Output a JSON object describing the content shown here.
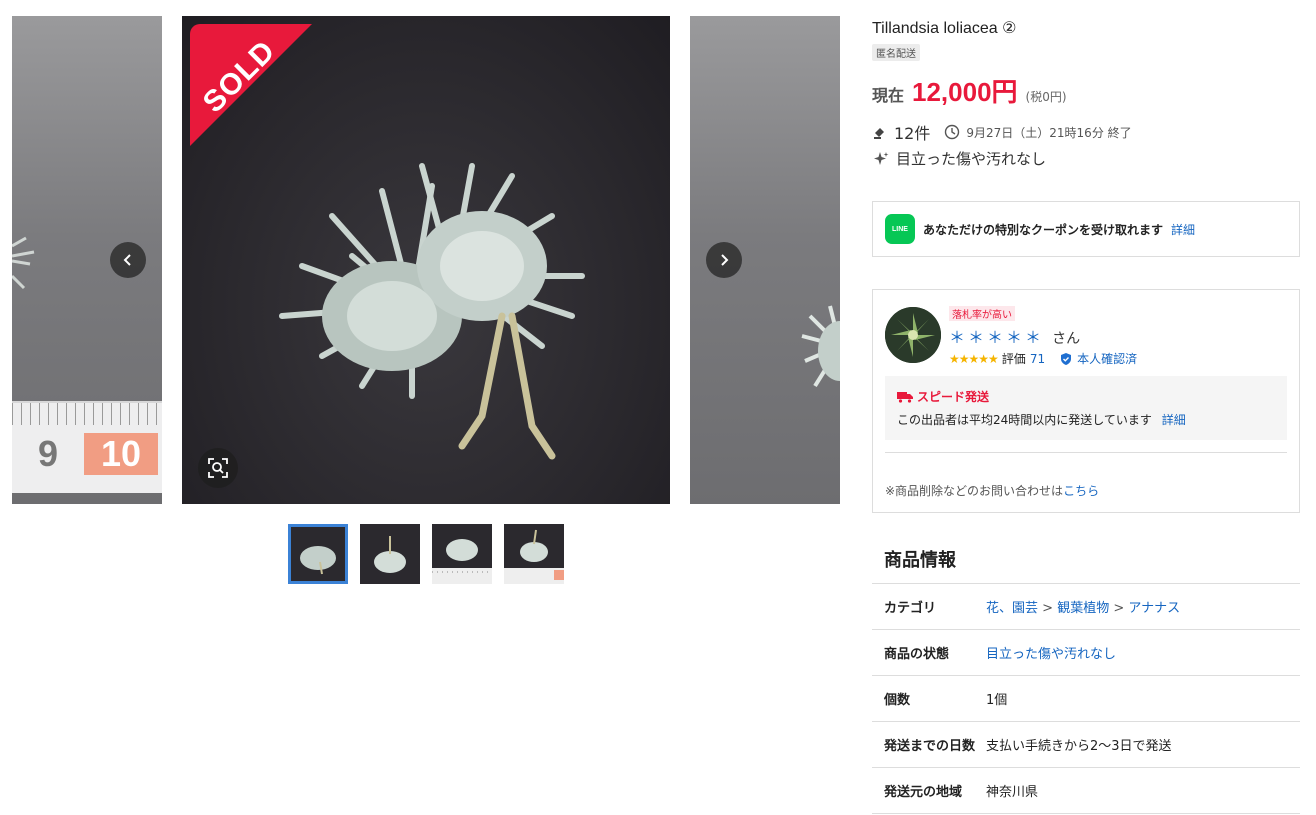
{
  "gallery": {
    "sold_label": "SOLD",
    "ruler_left": "9",
    "ruler_right": "10",
    "thumb_count": 4
  },
  "item": {
    "title": "Tillandsia loliacea ②",
    "anon_badge": "匿名配送",
    "price_label": "現在",
    "price": "12,000円",
    "tax": "(税0円)",
    "bids": "12件",
    "end_time": "9月27日（土）21時16分 終了",
    "condition": "目立った傷や汚れなし"
  },
  "coupon": {
    "line_label": "LINE",
    "text": "あなただけの特別なクーポンを受け取れます",
    "link": "詳細"
  },
  "seller": {
    "tag": "落札率が高い",
    "name": "＊＊＊＊＊",
    "suffix": "さん",
    "stars": "★★★★★",
    "rating_label": "評価",
    "rating_count": "71",
    "verified": "本人確認済",
    "speed_title": "スピード発送",
    "speed_desc": "この出品者は平均24時間以内に発送しています",
    "speed_link": "詳細",
    "inquiry_text": "※商品削除などのお問い合わせは",
    "inquiry_link": "こちら"
  },
  "spec": {
    "title": "商品情報",
    "rows": [
      {
        "label": "カテゴリ",
        "cat1": "花、園芸",
        "sep1": ">",
        "cat2": "観葉植物",
        "sep2": ">",
        "cat3": "アナナス"
      },
      {
        "label": "商品の状態",
        "value": "目立った傷や汚れなし"
      },
      {
        "label": "個数",
        "value": "1個"
      },
      {
        "label": "発送までの日数",
        "value": "支払い手続きから2〜3日で発送"
      },
      {
        "label": "発送元の地域",
        "value": "神奈川県"
      }
    ]
  },
  "colors": {
    "accent_red": "#e8193b",
    "link_blue": "#1565c0",
    "line_green": "#06c755"
  }
}
